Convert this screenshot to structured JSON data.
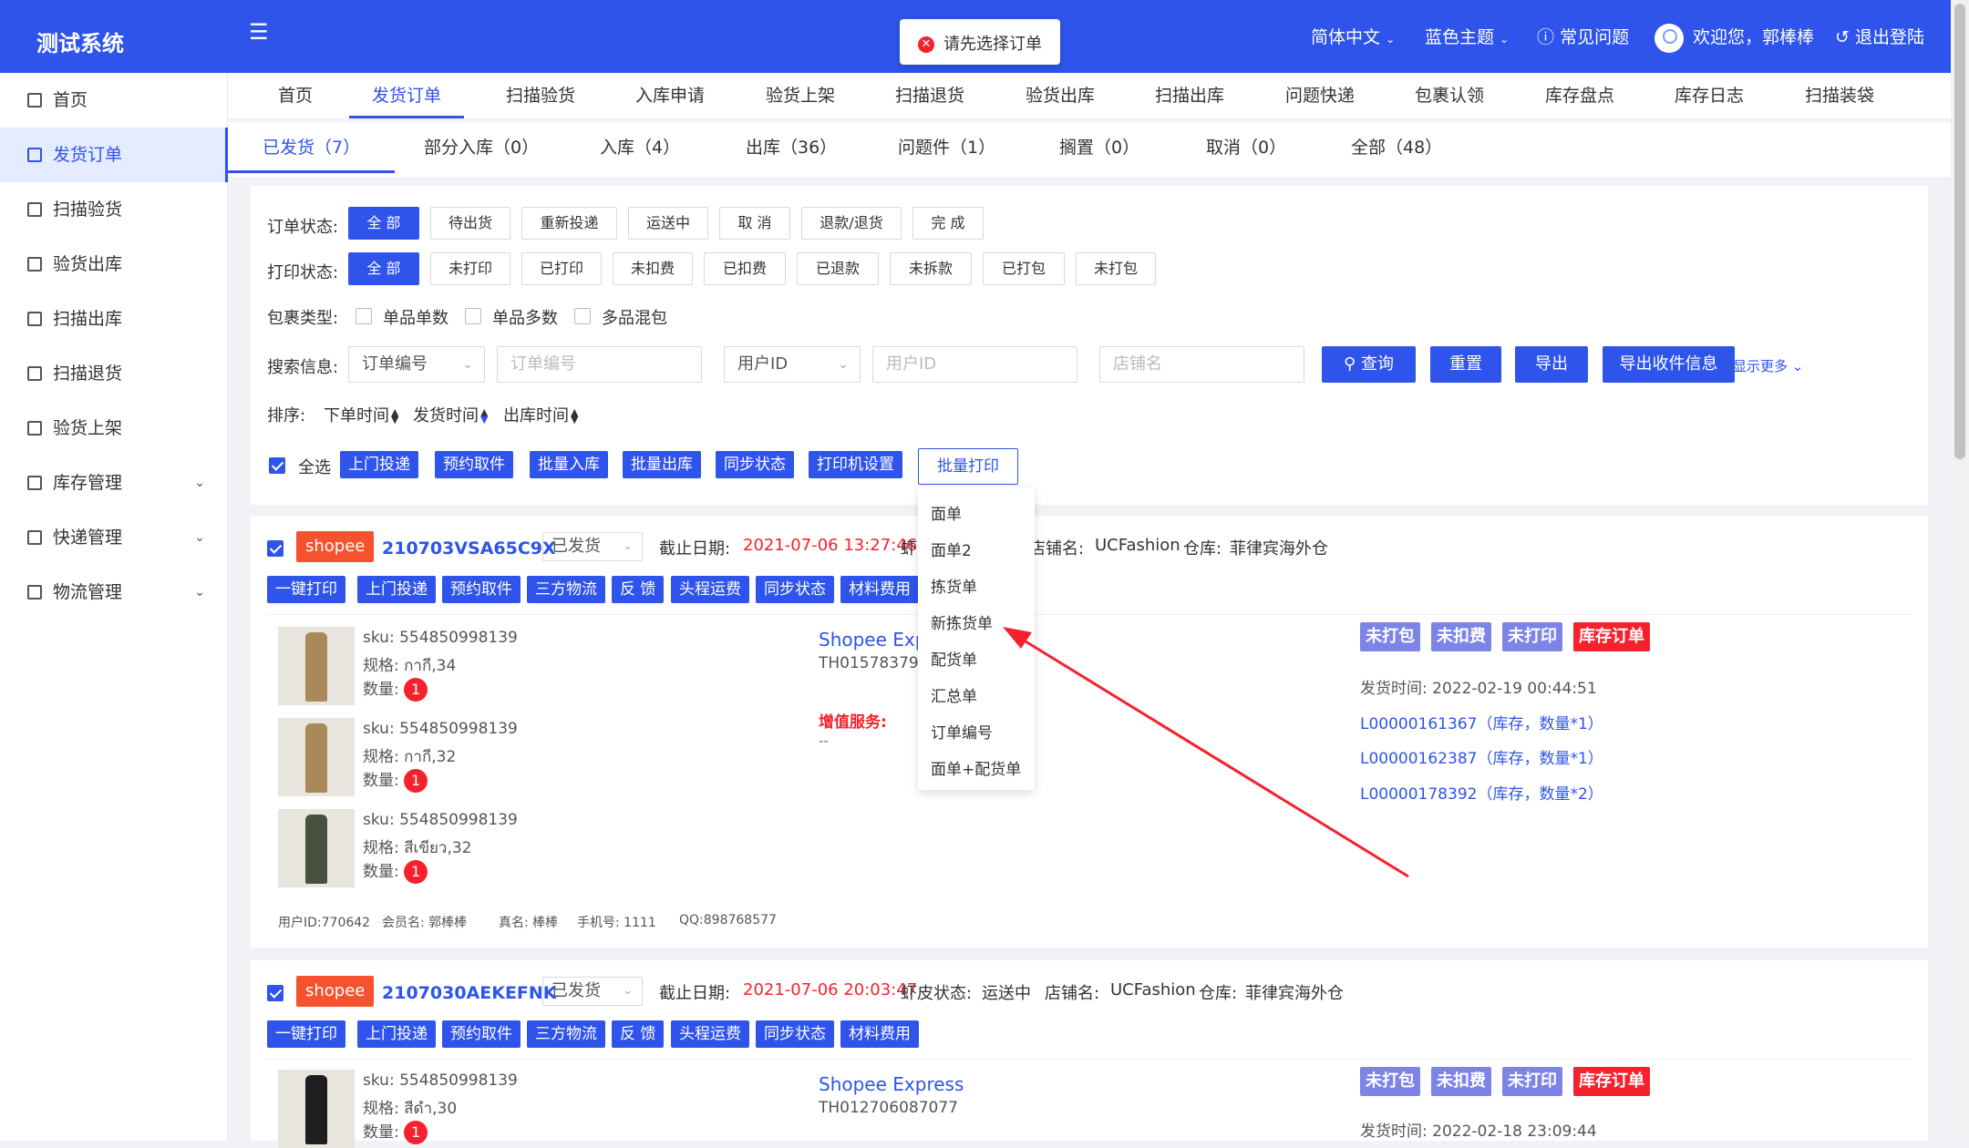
{
  "app": {
    "title": "测试系统"
  },
  "toast": {
    "message": "请先选择订单"
  },
  "topbar": {
    "language": "简体中文",
    "theme": "蓝色主题",
    "faq": "常见问题",
    "welcome": "欢迎您，郭棒棒",
    "logout": "退出登陆"
  },
  "sidebar": {
    "items": [
      {
        "label": "首页"
      },
      {
        "label": "发货订单"
      },
      {
        "label": "扫描验货"
      },
      {
        "label": "验货出库"
      },
      {
        "label": "扫描出库"
      },
      {
        "label": "扫描退货"
      },
      {
        "label": "验货上架"
      },
      {
        "label": "库存管理"
      },
      {
        "label": "快递管理"
      },
      {
        "label": "物流管理"
      }
    ]
  },
  "nav": {
    "items": [
      "首页",
      "发货订单",
      "扫描验货",
      "入库申请",
      "验货上架",
      "扫描退货",
      "验货出库",
      "扫描出库",
      "问题快递",
      "包裹认领",
      "库存盘点",
      "库存日志",
      "扫描装袋"
    ]
  },
  "subtabs": [
    "已发货（7）",
    "部分入库（0）",
    "入库（4）",
    "出库（36）",
    "问题件（1）",
    "搁置（0）",
    "取消（0）",
    "全部（48）"
  ],
  "filter": {
    "order_status_label": "订单状态:",
    "order_status": [
      "全 部",
      "待出货",
      "重新投递",
      "运送中",
      "取 消",
      "退款/退货",
      "完 成"
    ],
    "print_status_label": "打印状态:",
    "print_status": [
      "全 部",
      "未打印",
      "已打印",
      "未扣费",
      "已扣费",
      "已退款",
      "未拆款",
      "已打包",
      "未打包"
    ],
    "package_type_label": "包裹类型:",
    "package_types": [
      "单品单数",
      "单品多数",
      "多品混包"
    ],
    "search_label": "搜索信息:",
    "search_field1": "订单编号",
    "search_input1_placeholder": "订单编号",
    "search_field2": "用户ID",
    "search_input2_placeholder": "用户ID",
    "search_input3_placeholder": "店铺名",
    "query": "查询",
    "reset": "重置",
    "export": "导出",
    "export_receiver": "导出收件信息",
    "show_more": "显示更多",
    "sort_label": "排序:",
    "sorts": [
      "下单时间",
      "发货时间",
      "出库时间"
    ],
    "select_all": "全选",
    "bulk_actions": [
      "上门投递",
      "预约取件",
      "批量入库",
      "批量出库",
      "同步状态",
      "打印机设置"
    ],
    "bulk_print": "批量打印"
  },
  "print_menu": [
    "面单",
    "面单2",
    "拣货单",
    "新拣货单",
    "配货单",
    "汇总单",
    "订单编号",
    "面单+配货单"
  ],
  "orders": [
    {
      "platform": "shopee",
      "order_id": "210703VSA65C9X",
      "status": "已发货",
      "deadline_label": "截止日期:",
      "deadline": "2021-07-06 13:27:46",
      "shopee_status_label": "虾",
      "shop_label": "店铺名:",
      "shop": "UCFashion",
      "warehouse_label": "仓库:",
      "warehouse": "菲律宾海外仓",
      "actions": [
        "一键打印",
        "上门投递",
        "预约取件",
        "三方物流",
        "反 馈",
        "头程运费",
        "同步状态",
        "材料费用"
      ],
      "items": [
        {
          "sku": "sku: 554850998139",
          "spec": "规格:  กากี,34",
          "qty_label": "数量:",
          "qty": "1"
        },
        {
          "sku": "sku: 554850998139",
          "spec": "规格:  กากี,32",
          "qty_label": "数量:",
          "qty": "1"
        },
        {
          "sku": "sku: 554850998139",
          "spec": "规格:  สีเขียว,32",
          "qty_label": "数量:",
          "qty": "1"
        }
      ],
      "carrier": "Shopee Exp",
      "tracking": "TH015783792",
      "value_added_label": "增值服务:",
      "value_added": "--",
      "tags": [
        "未打包",
        "未扣费",
        "未打印",
        "库存订单"
      ],
      "ship_time": "发货时间:  2022-02-19 00:44:51",
      "stock_links": [
        "L00000161367（库存，数量*1）",
        "L00000162387（库存，数量*1）",
        "L00000178392（库存，数量*2）"
      ],
      "user_info": {
        "user_id": "用户ID:770642",
        "member": "会员名:  郭棒棒",
        "real_name": "真名:  棒棒",
        "phone": "手机号:  1111",
        "qq": "QQ:898768577"
      }
    },
    {
      "platform": "shopee",
      "order_id": "2107030AEKEFNK",
      "status": "已发货",
      "deadline_label": "截止日期:",
      "deadline": "2021-07-06 20:03:47",
      "shopee_status_label": "虾皮状态:",
      "shopee_status": "运送中",
      "shop_label": "店铺名:",
      "shop": "UCFashion",
      "warehouse_label": "仓库:",
      "warehouse": "菲律宾海外仓",
      "actions": [
        "一键打印",
        "上门投递",
        "预约取件",
        "三方物流",
        "反 馈",
        "头程运费",
        "同步状态",
        "材料费用"
      ],
      "items": [
        {
          "sku": "sku: 554850998139",
          "spec": "规格:  สีดำ,30",
          "qty_label": "数量:",
          "qty": "1"
        }
      ],
      "carrier": "Shopee Express",
      "tracking": "TH012706087077",
      "tags": [
        "未打包",
        "未扣费",
        "未打印",
        "库存订单"
      ],
      "ship_time": "发货时间:  2022-02-18 23:09:44"
    }
  ],
  "colors": {
    "primary": "#2f54eb",
    "danger": "#f5222d",
    "shopee": "#f5522d",
    "tag_purple": "#7e83e8"
  }
}
